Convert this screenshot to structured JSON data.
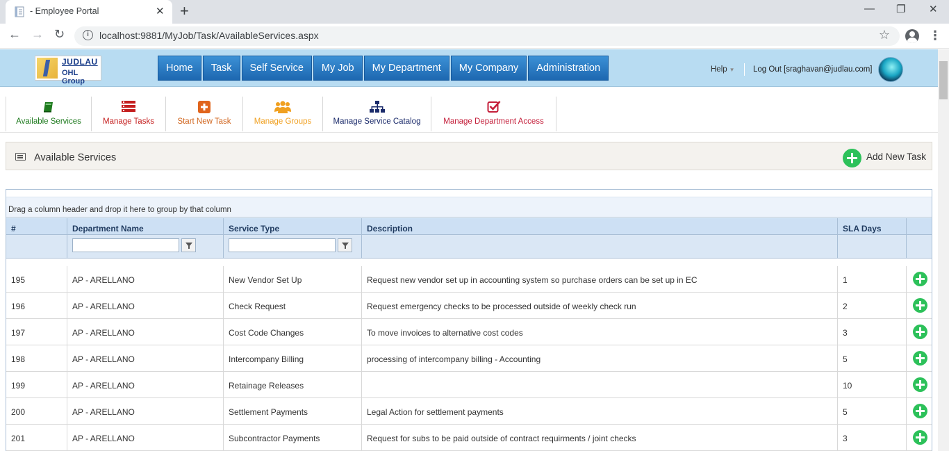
{
  "browser": {
    "tab_title": "- Employee Portal",
    "url": "localhost:9881/MyJob/Task/AvailableServices.aspx"
  },
  "header": {
    "logo_line1": "JUDLAU",
    "logo_line2": "OHL Group",
    "nav": [
      "Home",
      "Task",
      "Self Service",
      "My Job",
      "My Department",
      "My Company",
      "Administration"
    ],
    "help_label": "Help",
    "logout_label": "Log Out [sraghavan@judlau.com]"
  },
  "actions": [
    {
      "label": "Available Services",
      "color": "#1e7a1e",
      "icon": "book-icon"
    },
    {
      "label": "Manage Tasks",
      "color": "#c41e1e",
      "icon": "list-icon"
    },
    {
      "label": "Start New Task",
      "color": "#d0641c",
      "icon": "plus-square-icon"
    },
    {
      "label": "Manage Groups",
      "color": "#f0a020",
      "icon": "group-icon"
    },
    {
      "label": "Manage Service Catalog",
      "color": "#1a2a6a",
      "icon": "sitemap-icon"
    },
    {
      "label": "Manage Department Access",
      "color": "#c41e3a",
      "icon": "check-square-icon"
    }
  ],
  "section": {
    "title": "Available Services",
    "add_label": "Add New Task"
  },
  "grid": {
    "group_hint": "Drag a column header and drop it here to group by that column",
    "columns": [
      "#",
      "Department Name",
      "Service Type",
      "Description",
      "SLA Days"
    ],
    "filter_department": "",
    "filter_service": "",
    "rows": [
      {
        "id": "195",
        "dept": "AP - ARELLANO",
        "service": "New Vendor Set Up",
        "desc": "Request new vendor set up in accounting system so purchase orders can be set up in EC",
        "sla": "1"
      },
      {
        "id": "196",
        "dept": "AP - ARELLANO",
        "service": "Check Request",
        "desc": "Request emergency checks to be processed outside of weekly check run",
        "sla": "2"
      },
      {
        "id": "197",
        "dept": "AP - ARELLANO",
        "service": "Cost Code Changes",
        "desc": "To move invoices to alternative cost codes",
        "sla": "3"
      },
      {
        "id": "198",
        "dept": "AP - ARELLANO",
        "service": "Intercompany Billing",
        "desc": "processing of intercompany billing - Accounting",
        "sla": "5"
      },
      {
        "id": "199",
        "dept": "AP - ARELLANO",
        "service": "Retainage Releases",
        "desc": "",
        "sla": "10"
      },
      {
        "id": "200",
        "dept": "AP - ARELLANO",
        "service": "Settlement Payments",
        "desc": "Legal Action for settlement payments",
        "sla": "5"
      },
      {
        "id": "201",
        "dept": "AP - ARELLANO",
        "service": "Subcontractor Payments",
        "desc": "Request for subs to be paid outside of contract requirments / joint checks",
        "sla": "3"
      }
    ]
  },
  "colors": {
    "header_bg": "#b8dcf2",
    "nav_button": "#2a7cc4",
    "add_green": "#2dc15a",
    "grid_header": "#cde0f4"
  }
}
